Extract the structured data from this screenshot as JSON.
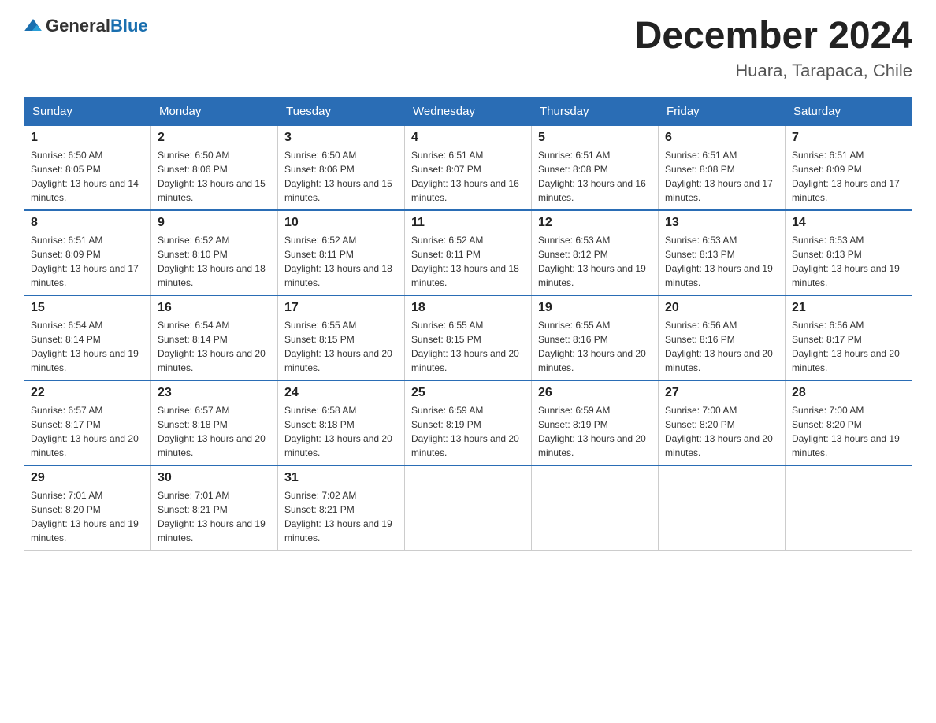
{
  "logo": {
    "text_general": "General",
    "text_blue": "Blue"
  },
  "title": "December 2024",
  "subtitle": "Huara, Tarapaca, Chile",
  "headers": [
    "Sunday",
    "Monday",
    "Tuesday",
    "Wednesday",
    "Thursday",
    "Friday",
    "Saturday"
  ],
  "weeks": [
    [
      {
        "day": "1",
        "sunrise": "6:50 AM",
        "sunset": "8:05 PM",
        "daylight": "13 hours and 14 minutes."
      },
      {
        "day": "2",
        "sunrise": "6:50 AM",
        "sunset": "8:06 PM",
        "daylight": "13 hours and 15 minutes."
      },
      {
        "day": "3",
        "sunrise": "6:50 AM",
        "sunset": "8:06 PM",
        "daylight": "13 hours and 15 minutes."
      },
      {
        "day": "4",
        "sunrise": "6:51 AM",
        "sunset": "8:07 PM",
        "daylight": "13 hours and 16 minutes."
      },
      {
        "day": "5",
        "sunrise": "6:51 AM",
        "sunset": "8:08 PM",
        "daylight": "13 hours and 16 minutes."
      },
      {
        "day": "6",
        "sunrise": "6:51 AM",
        "sunset": "8:08 PM",
        "daylight": "13 hours and 17 minutes."
      },
      {
        "day": "7",
        "sunrise": "6:51 AM",
        "sunset": "8:09 PM",
        "daylight": "13 hours and 17 minutes."
      }
    ],
    [
      {
        "day": "8",
        "sunrise": "6:51 AM",
        "sunset": "8:09 PM",
        "daylight": "13 hours and 17 minutes."
      },
      {
        "day": "9",
        "sunrise": "6:52 AM",
        "sunset": "8:10 PM",
        "daylight": "13 hours and 18 minutes."
      },
      {
        "day": "10",
        "sunrise": "6:52 AM",
        "sunset": "8:11 PM",
        "daylight": "13 hours and 18 minutes."
      },
      {
        "day": "11",
        "sunrise": "6:52 AM",
        "sunset": "8:11 PM",
        "daylight": "13 hours and 18 minutes."
      },
      {
        "day": "12",
        "sunrise": "6:53 AM",
        "sunset": "8:12 PM",
        "daylight": "13 hours and 19 minutes."
      },
      {
        "day": "13",
        "sunrise": "6:53 AM",
        "sunset": "8:13 PM",
        "daylight": "13 hours and 19 minutes."
      },
      {
        "day": "14",
        "sunrise": "6:53 AM",
        "sunset": "8:13 PM",
        "daylight": "13 hours and 19 minutes."
      }
    ],
    [
      {
        "day": "15",
        "sunrise": "6:54 AM",
        "sunset": "8:14 PM",
        "daylight": "13 hours and 19 minutes."
      },
      {
        "day": "16",
        "sunrise": "6:54 AM",
        "sunset": "8:14 PM",
        "daylight": "13 hours and 20 minutes."
      },
      {
        "day": "17",
        "sunrise": "6:55 AM",
        "sunset": "8:15 PM",
        "daylight": "13 hours and 20 minutes."
      },
      {
        "day": "18",
        "sunrise": "6:55 AM",
        "sunset": "8:15 PM",
        "daylight": "13 hours and 20 minutes."
      },
      {
        "day": "19",
        "sunrise": "6:55 AM",
        "sunset": "8:16 PM",
        "daylight": "13 hours and 20 minutes."
      },
      {
        "day": "20",
        "sunrise": "6:56 AM",
        "sunset": "8:16 PM",
        "daylight": "13 hours and 20 minutes."
      },
      {
        "day": "21",
        "sunrise": "6:56 AM",
        "sunset": "8:17 PM",
        "daylight": "13 hours and 20 minutes."
      }
    ],
    [
      {
        "day": "22",
        "sunrise": "6:57 AM",
        "sunset": "8:17 PM",
        "daylight": "13 hours and 20 minutes."
      },
      {
        "day": "23",
        "sunrise": "6:57 AM",
        "sunset": "8:18 PM",
        "daylight": "13 hours and 20 minutes."
      },
      {
        "day": "24",
        "sunrise": "6:58 AM",
        "sunset": "8:18 PM",
        "daylight": "13 hours and 20 minutes."
      },
      {
        "day": "25",
        "sunrise": "6:59 AM",
        "sunset": "8:19 PM",
        "daylight": "13 hours and 20 minutes."
      },
      {
        "day": "26",
        "sunrise": "6:59 AM",
        "sunset": "8:19 PM",
        "daylight": "13 hours and 20 minutes."
      },
      {
        "day": "27",
        "sunrise": "7:00 AM",
        "sunset": "8:20 PM",
        "daylight": "13 hours and 20 minutes."
      },
      {
        "day": "28",
        "sunrise": "7:00 AM",
        "sunset": "8:20 PM",
        "daylight": "13 hours and 19 minutes."
      }
    ],
    [
      {
        "day": "29",
        "sunrise": "7:01 AM",
        "sunset": "8:20 PM",
        "daylight": "13 hours and 19 minutes."
      },
      {
        "day": "30",
        "sunrise": "7:01 AM",
        "sunset": "8:21 PM",
        "daylight": "13 hours and 19 minutes."
      },
      {
        "day": "31",
        "sunrise": "7:02 AM",
        "sunset": "8:21 PM",
        "daylight": "13 hours and 19 minutes."
      },
      null,
      null,
      null,
      null
    ]
  ]
}
